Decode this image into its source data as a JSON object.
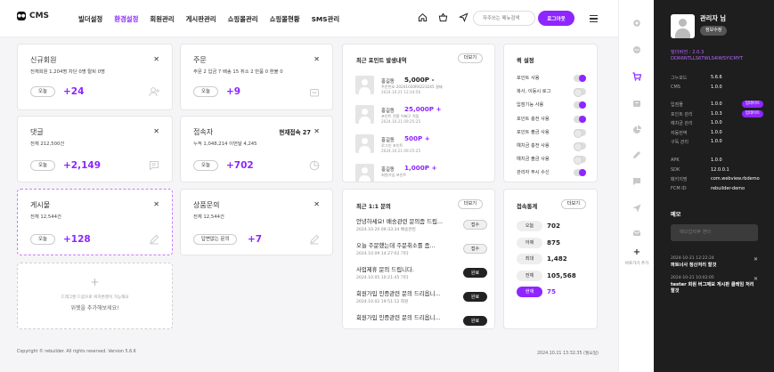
{
  "header": {
    "logo": "CMS",
    "logo_mark": "CMS",
    "nav": [
      "빌더설정",
      "환경설정",
      "회원관리",
      "게시판관리",
      "쇼핑몰관리",
      "쇼핑몰현황",
      "SMS관리"
    ],
    "search_placeholder": "자주쓰는 메뉴검색",
    "logout": "로그아웃"
  },
  "cards": {
    "members": {
      "title": "신규회원",
      "stats": "전체회원 1,204명  차단 0명  탈퇴 0명",
      "pill": "오늘",
      "value": "+24"
    },
    "orders": {
      "title": "주문",
      "stats": "주문 2  입금 7  배송 15  취소 2  반품 0  환불 0",
      "pill": "오늘",
      "value": "+9"
    },
    "comments": {
      "title": "댓글",
      "stats": "전체 212,500건",
      "pill": "오늘",
      "value": "+2,149"
    },
    "visitors": {
      "title": "접속자",
      "now": "현재접속 27",
      "stats": "누적 1,048,214    이번달 4,245",
      "pill": "오늘",
      "value": "+702"
    },
    "posts": {
      "title": "게시물",
      "stats": "전체 12,544건",
      "pill": "오늘",
      "value": "+128"
    },
    "inquiry": {
      "title": "상품문의",
      "stats": "전체 12,544건",
      "pill": "답변없는 문의",
      "value": "+7"
    },
    "add": {
      "line1": "드래그앤 드랍으로 위치변경이 가능해요",
      "line2": "위젯을 추가해보세요!"
    }
  },
  "points": {
    "title": "최근 포인트 발생내역",
    "more": "더보기",
    "rows": [
      {
        "name": "홍길동",
        "amount": "5,000P -",
        "desc": "주문번호 20241020R6223245 결제",
        "date": "2024.10.21 12:34:56",
        "plus": false
      },
      {
        "name": "홍길동",
        "amount": "25,000P +",
        "desc": "포인트 전환 어쩌구 적립",
        "date": "2024.10.21 09:25:25",
        "plus": true
      },
      {
        "name": "홍길동",
        "amount": "500P +",
        "desc": "로그인 포인트",
        "date": "2024.10.21 09:25:25",
        "plus": true
      },
      {
        "name": "홍길동",
        "amount": "1,000P +",
        "desc": "회원가입 포인트",
        "date": "",
        "plus": true
      }
    ]
  },
  "inquiries": {
    "title": "최근 1:1 문의",
    "more": "더보기",
    "rows": [
      {
        "title": "안녕하세요! 배송관련 문의좀 드립...",
        "meta": "2024.10.20 09:33:34   배송관련",
        "status": "접수",
        "done": false
      },
      {
        "title": "오늘 주문했는데 주문취소를 좀...",
        "meta": "2024.10.09 14:27:02   기타",
        "status": "접수",
        "done": false
      },
      {
        "title": "사업제휴 문의 드립니다.",
        "meta": "2024.10.05 10:21:45   기타",
        "status": "완료",
        "done": true
      },
      {
        "title": "회원가입 인증관련 문의 드리옵니...",
        "meta": "2024.10.02 19:51:12   회원",
        "status": "완료",
        "done": true
      },
      {
        "title": "회원가입 인증관련 문의 드리옵니...",
        "meta": "",
        "status": "완료",
        "done": true
      }
    ]
  },
  "quick": {
    "title": "퀵 설정",
    "rows": [
      {
        "label": "포인트 사용",
        "on": true
      },
      {
        "label": "복사, 이동시 로그",
        "on": false
      },
      {
        "label": "입점기능 사용",
        "on": true
      },
      {
        "label": "포인트 충전 사용",
        "on": true
      },
      {
        "label": "포인트 출금 사용",
        "on": false
      },
      {
        "label": "예치금 충전 사용",
        "on": false
      },
      {
        "label": "예치금 출금 사용",
        "on": false
      },
      {
        "label": "관리자 푸시 수신",
        "on": true
      }
    ]
  },
  "stats": {
    "title": "접속통계",
    "more": "더보기",
    "rows": [
      {
        "label": "오늘",
        "value": "702",
        "on": false
      },
      {
        "label": "어제",
        "value": "875",
        "on": false
      },
      {
        "label": "최대",
        "value": "1,482",
        "on": false
      },
      {
        "label": "전체",
        "value": "105,568",
        "on": false
      },
      {
        "label": "현재",
        "value": "75",
        "on": true
      }
    ]
  },
  "rail": {
    "add_label": "바로가기 추가"
  },
  "side": {
    "admin": "관리자 님",
    "edit": "정보수정",
    "version": "빌더버전 : 2.0.3",
    "code": "DDR6NTLLS6TWLS4IWSYICMYT",
    "info": [
      {
        "k": "그누보드",
        "v": "5.6.6"
      },
      {
        "k": "CMS",
        "v": "1.0.0"
      }
    ],
    "apps": [
      {
        "k": "입점몰",
        "v": "1.0.0",
        "badge": "업데이트"
      },
      {
        "k": "포인트 관리",
        "v": "1.0.3",
        "badge": "업데이트"
      },
      {
        "k": "예치금 관리",
        "v": "1.0.0",
        "badge": ""
      },
      {
        "k": "자동번역",
        "v": "1.0.0",
        "badge": ""
      },
      {
        "k": "구독 관리",
        "v": "1.0.0",
        "badge": ""
      }
    ],
    "device": [
      {
        "k": "APK",
        "v": "1.0.0"
      },
      {
        "k": "SDK",
        "v": "12.0.0.1"
      },
      {
        "k": "패키지명",
        "v": "com.webview.rbdemo"
      },
      {
        "k": "FCM ID",
        "v": "rebuilder-demo"
      }
    ],
    "memo_title": "메모",
    "memo_placeholder": "메모입력후 엔터",
    "memos": [
      {
        "date": "2024-10-21 12:22:24",
        "text": "파트너사 정산처리 할것"
      },
      {
        "date": "2024-10-21 10:02:05",
        "text": "tester 회원 버그제보 게시판 클레임 처리 할것"
      }
    ]
  },
  "footer": {
    "copyright": "Copyright © rebuilder. All rights reserved. Version 5.6.6",
    "datetime": "2024.10.21 13:32:35 (월요일)"
  }
}
